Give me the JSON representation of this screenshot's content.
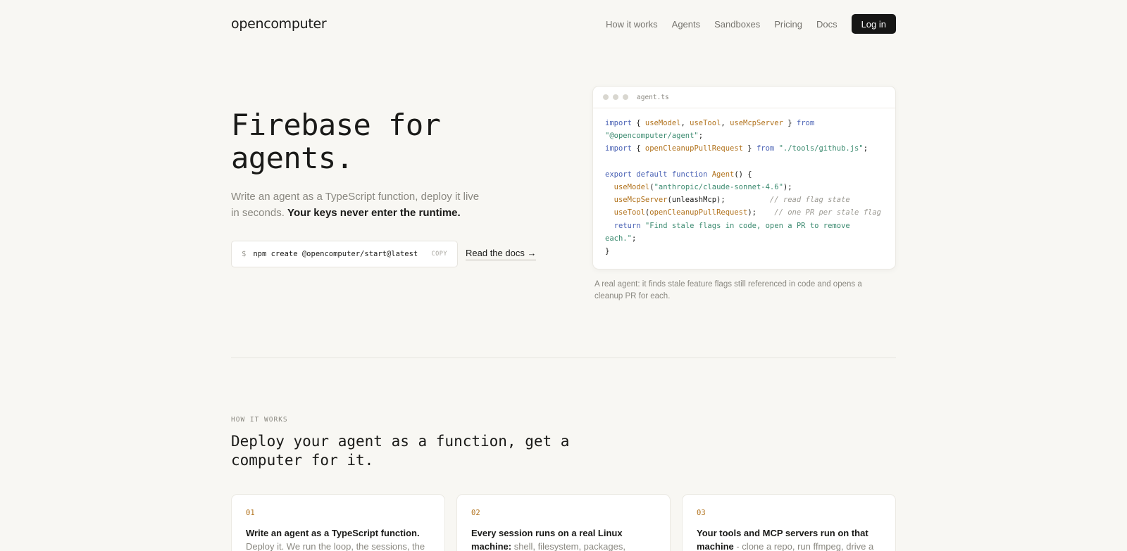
{
  "header": {
    "logo": "opencomputer",
    "nav": [
      "How it works",
      "Agents",
      "Sandboxes",
      "Pricing",
      "Docs"
    ],
    "login": "Log in"
  },
  "hero": {
    "title_line1": "Firebase for",
    "title_line2": "agents.",
    "subtitle_plain": "Write an agent as a TypeScript function, deploy it live in seconds. ",
    "subtitle_bold": "Your keys never enter the runtime.",
    "command": "npm create @opencomputer/start@latest",
    "command_prompt": "$",
    "copy_label": "COPY",
    "docs_link": "Read the docs →"
  },
  "code": {
    "filename": "agent.ts",
    "caption": "A real agent: it finds stale feature flags still referenced in code and opens a cleanup PR for each."
  },
  "how": {
    "label": "HOW IT WORKS",
    "title": "Deploy your agent as a function, get a computer for it.",
    "steps": [
      {
        "num": "01",
        "bold": "Write an agent as a TypeScript function.",
        "text": " Deploy it. We run the loop, the sessions, the"
      },
      {
        "num": "02",
        "bold": "Every session runs on a real Linux machine:",
        "text": " shell, filesystem, packages,"
      },
      {
        "num": "03",
        "bold": "Your tools and MCP servers run on that machine",
        "text": " - clone a repo, run ffmpeg, drive a"
      }
    ]
  },
  "colors": {
    "background": "#f8f7f3",
    "keyword": "#4b63b5",
    "function": "#b1721c",
    "string": "#3c8b70"
  }
}
